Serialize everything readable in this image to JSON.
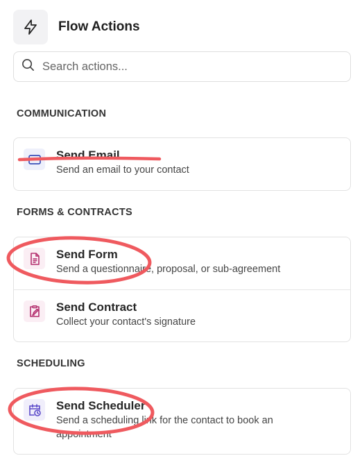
{
  "header": {
    "title": "Flow Actions",
    "icon": "lightning-bolt-icon"
  },
  "search": {
    "placeholder": "Search actions...",
    "value": ""
  },
  "sections": [
    {
      "title": "COMMUNICATION",
      "items": [
        {
          "title": "Send Email",
          "description": "Send an email to your contact",
          "icon": "envelope-icon",
          "icon_color": "#3b4fb8",
          "icon_bg": "#eef0fb"
        }
      ]
    },
    {
      "title": "FORMS & CONTRACTS",
      "items": [
        {
          "title": "Send Form",
          "description": "Send a questionnaire, proposal, or sub-agreement",
          "icon": "document-icon",
          "icon_color": "#b4306f",
          "icon_bg": "#fbeef4"
        },
        {
          "title": "Send Contract",
          "description": "Collect your contact's signature",
          "icon": "contract-sign-icon",
          "icon_color": "#b4306f",
          "icon_bg": "#fbeef4"
        }
      ]
    },
    {
      "title": "SCHEDULING",
      "items": [
        {
          "title": "Send Scheduler",
          "description": "Send a scheduling link for the contact to book an appointment",
          "icon": "calendar-clock-icon",
          "icon_color": "#5b49c9",
          "icon_bg": "#f0eefb"
        }
      ]
    }
  ],
  "annotations": {
    "color": "#ef5a5f",
    "strike_target": "Send Email",
    "circled_targets": [
      "Send Form",
      "Send Scheduler"
    ]
  }
}
